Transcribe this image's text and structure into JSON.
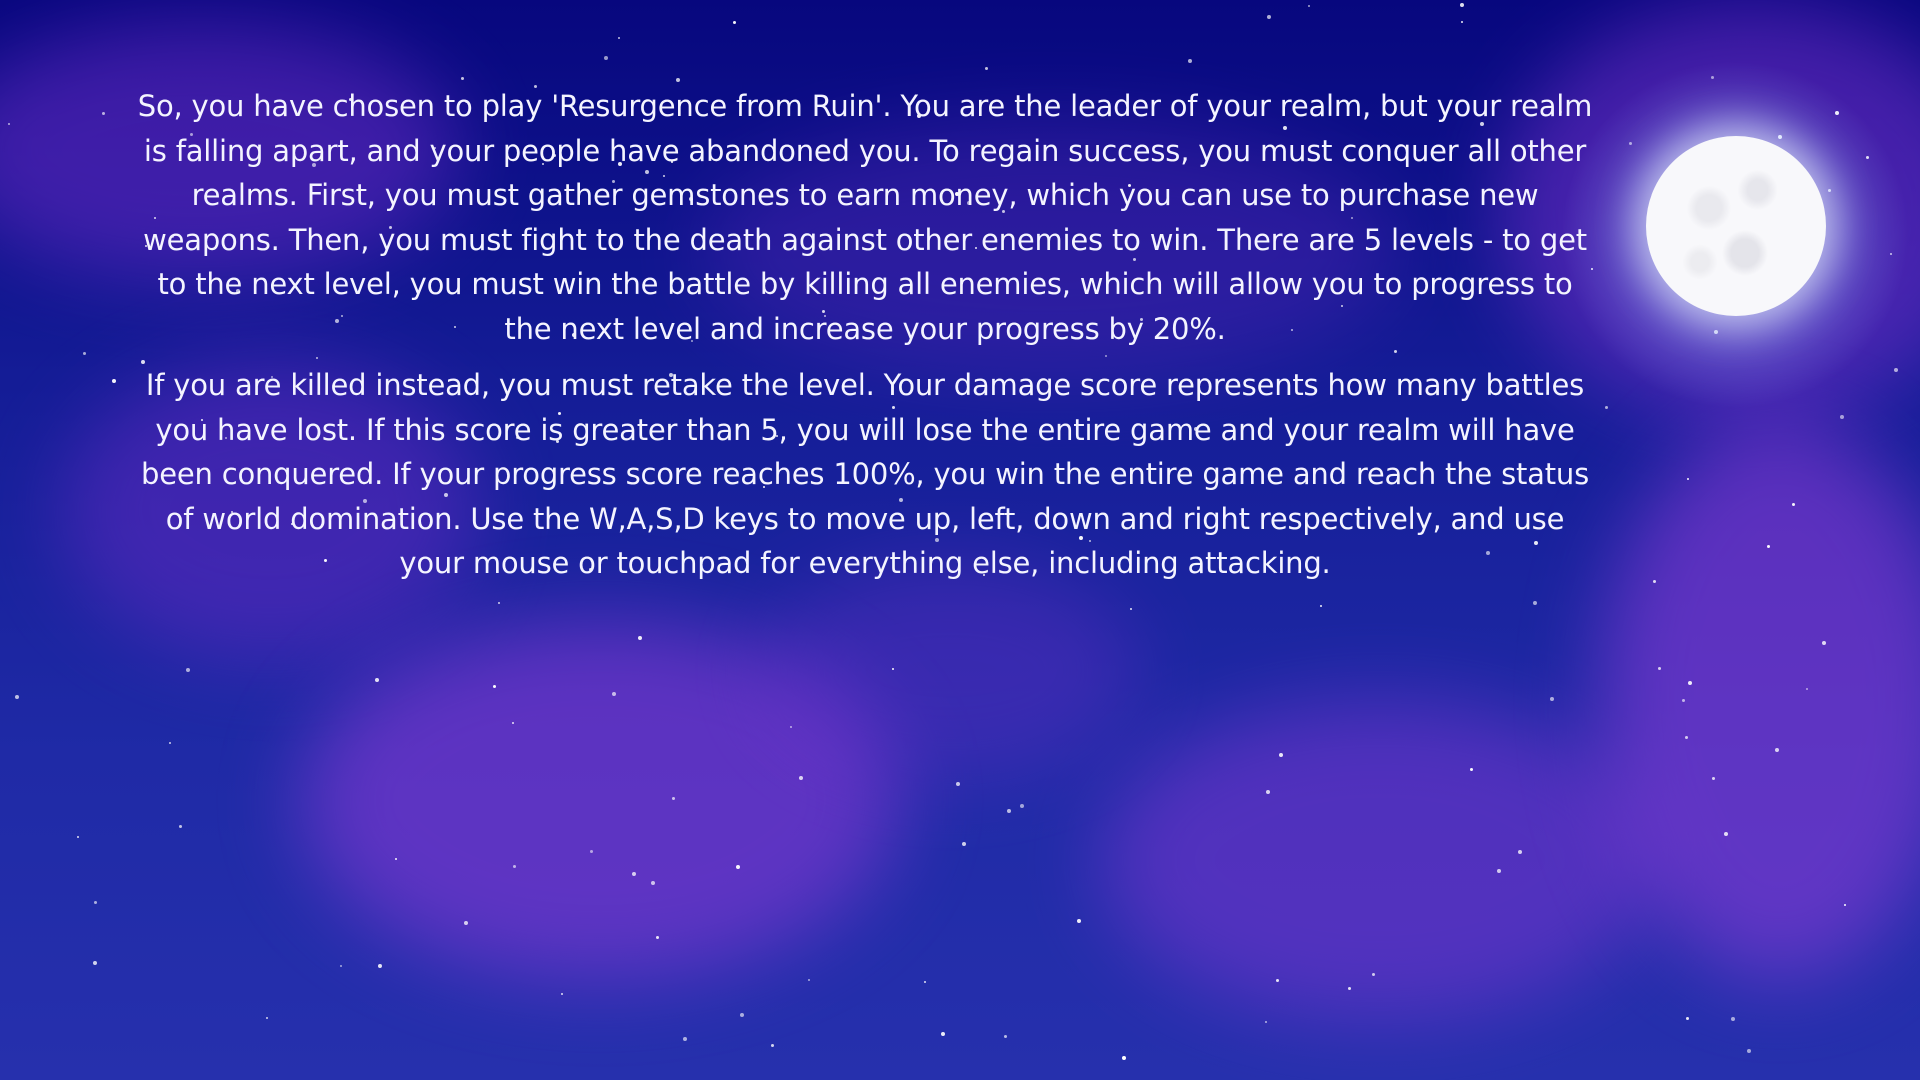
{
  "game": {
    "moon": "full-moon",
    "background": "night-sky-with-purple-clouds-and-stars",
    "intro_paragraph_1": "So, you have chosen to play 'Resurgence from Ruin'. You are the leader of your realm, but your realm is falling apart, and your people have abandoned you. To regain success, you must conquer all other realms. First, you must gather gemstones to earn money, which you can use to purchase new weapons. Then, you must fight to the death against other enemies to win. There are 5 levels - to get to the next level, you must win the battle by killing all enemies, which will allow you to progress to the next level and increase your progress by 20%.",
    "intro_paragraph_2": "If you are killed instead, you must retake the level. Your damage score represents how many battles you have lost. If this score is greater than 5, you will lose the entire game and your realm will have been conquered. If your progress score reaches 100%, you win the entire game and reach the status of world domination. Use the W,A,S,D keys to move up, left, down and right respectively, and use your mouse or touchpad for everything else, including attacking."
  },
  "colors": {
    "sky_top": "#07077e",
    "sky_bottom": "#2630ad",
    "cloud": "#8a35d6",
    "text": "#f4f4ff",
    "moon": "#f8f8fb"
  }
}
